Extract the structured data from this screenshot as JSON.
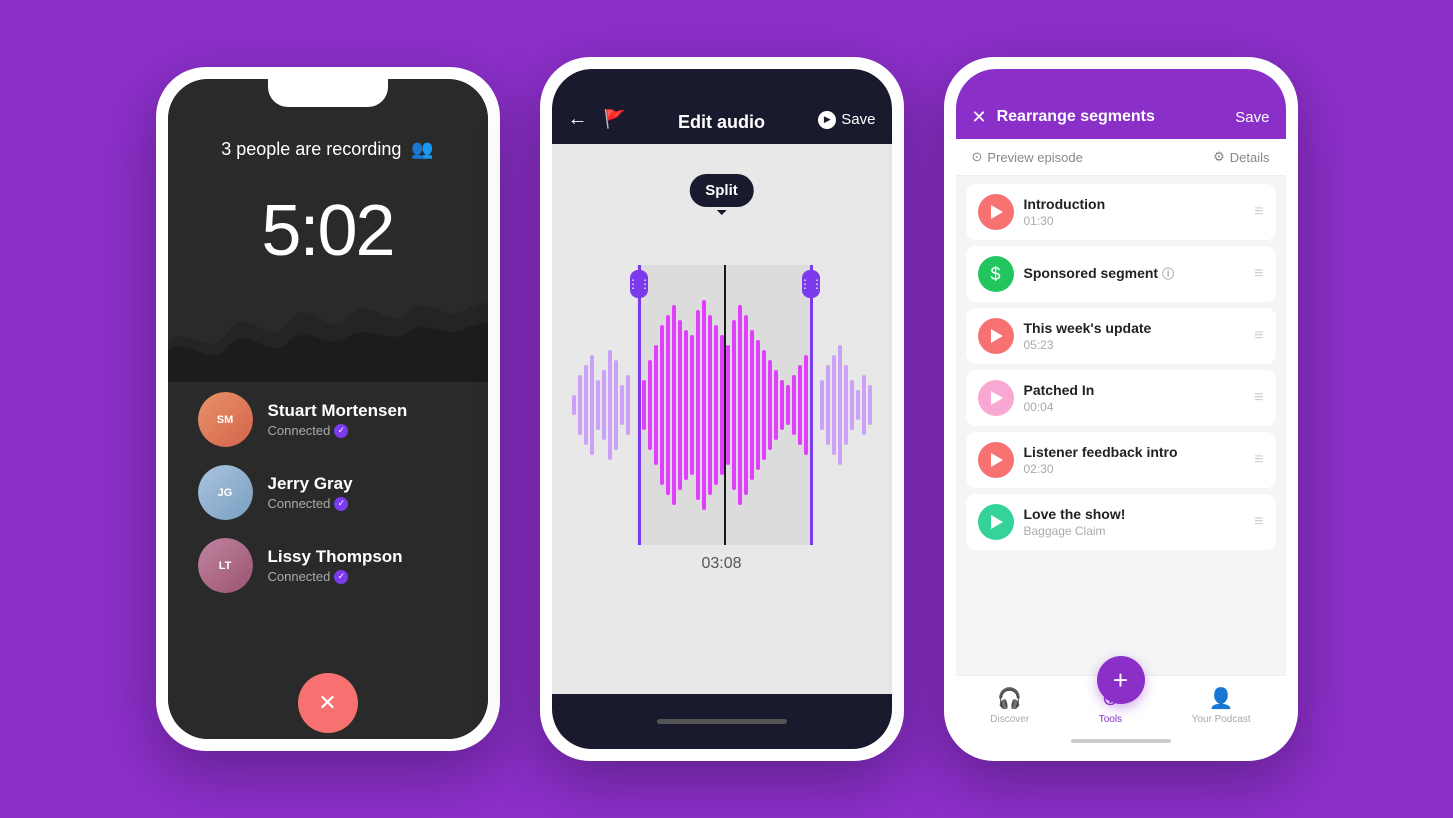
{
  "background_color": "#8B2FC9",
  "phone1": {
    "recording_title": "3 people are recording",
    "timer": "5:02",
    "participants": [
      {
        "name": "Stuart Mortensen",
        "status": "Connected",
        "color": "#E8936A",
        "initials": "SM"
      },
      {
        "name": "Jerry Gray",
        "status": "Connected",
        "color": "#8aaced",
        "initials": "JG"
      },
      {
        "name": "Lissy Thompson",
        "status": "Connected",
        "color": "#c084a0",
        "initials": "LT"
      }
    ],
    "end_call_label": "✕"
  },
  "phone2": {
    "title": "Edit audio",
    "save_label": "Save",
    "split_label": "Split",
    "time_display": "03:08"
  },
  "phone3": {
    "header_title": "Rearrange segments",
    "save_label": "Save",
    "preview_label": "Preview episode",
    "details_label": "Details",
    "segments": [
      {
        "name": "Introduction",
        "duration": "01:30",
        "color": "#f87171",
        "icon_type": "play"
      },
      {
        "name": "Sponsored segment",
        "duration": "",
        "color": "#22c55e",
        "icon_type": "dollar"
      },
      {
        "name": "This week's update",
        "duration": "05:23",
        "color": "#f87171",
        "icon_type": "play"
      },
      {
        "name": "Patched In",
        "duration": "00:04",
        "color": "#f9a8d4",
        "icon_type": "play"
      },
      {
        "name": "Listener feedback intro",
        "duration": "02:30",
        "color": "#f87171",
        "icon_type": "play"
      },
      {
        "name": "Love the show!",
        "duration": "Baggage Claim",
        "color": "#34d399",
        "icon_type": "play"
      }
    ],
    "nav_items": [
      {
        "label": "Discover",
        "icon": "🎧",
        "active": false
      },
      {
        "label": "Tools",
        "icon": "+",
        "active": true
      },
      {
        "label": "Your Podcast",
        "icon": "👤",
        "active": false
      }
    ]
  }
}
